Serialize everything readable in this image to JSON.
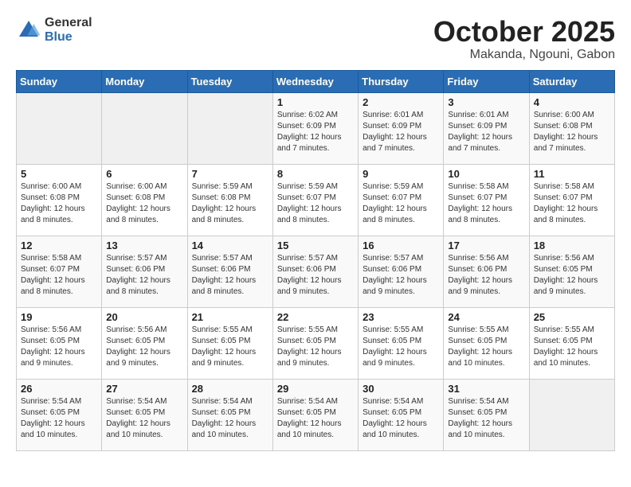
{
  "header": {
    "logo_general": "General",
    "logo_blue": "Blue",
    "title": "October 2025",
    "location": "Makanda, Ngouni, Gabon"
  },
  "weekdays": [
    "Sunday",
    "Monday",
    "Tuesday",
    "Wednesday",
    "Thursday",
    "Friday",
    "Saturday"
  ],
  "weeks": [
    [
      {
        "day": "",
        "info": ""
      },
      {
        "day": "",
        "info": ""
      },
      {
        "day": "",
        "info": ""
      },
      {
        "day": "1",
        "info": "Sunrise: 6:02 AM\nSunset: 6:09 PM\nDaylight: 12 hours\nand 7 minutes."
      },
      {
        "day": "2",
        "info": "Sunrise: 6:01 AM\nSunset: 6:09 PM\nDaylight: 12 hours\nand 7 minutes."
      },
      {
        "day": "3",
        "info": "Sunrise: 6:01 AM\nSunset: 6:09 PM\nDaylight: 12 hours\nand 7 minutes."
      },
      {
        "day": "4",
        "info": "Sunrise: 6:00 AM\nSunset: 6:08 PM\nDaylight: 12 hours\nand 7 minutes."
      }
    ],
    [
      {
        "day": "5",
        "info": "Sunrise: 6:00 AM\nSunset: 6:08 PM\nDaylight: 12 hours\nand 8 minutes."
      },
      {
        "day": "6",
        "info": "Sunrise: 6:00 AM\nSunset: 6:08 PM\nDaylight: 12 hours\nand 8 minutes."
      },
      {
        "day": "7",
        "info": "Sunrise: 5:59 AM\nSunset: 6:08 PM\nDaylight: 12 hours\nand 8 minutes."
      },
      {
        "day": "8",
        "info": "Sunrise: 5:59 AM\nSunset: 6:07 PM\nDaylight: 12 hours\nand 8 minutes."
      },
      {
        "day": "9",
        "info": "Sunrise: 5:59 AM\nSunset: 6:07 PM\nDaylight: 12 hours\nand 8 minutes."
      },
      {
        "day": "10",
        "info": "Sunrise: 5:58 AM\nSunset: 6:07 PM\nDaylight: 12 hours\nand 8 minutes."
      },
      {
        "day": "11",
        "info": "Sunrise: 5:58 AM\nSunset: 6:07 PM\nDaylight: 12 hours\nand 8 minutes."
      }
    ],
    [
      {
        "day": "12",
        "info": "Sunrise: 5:58 AM\nSunset: 6:07 PM\nDaylight: 12 hours\nand 8 minutes."
      },
      {
        "day": "13",
        "info": "Sunrise: 5:57 AM\nSunset: 6:06 PM\nDaylight: 12 hours\nand 8 minutes."
      },
      {
        "day": "14",
        "info": "Sunrise: 5:57 AM\nSunset: 6:06 PM\nDaylight: 12 hours\nand 8 minutes."
      },
      {
        "day": "15",
        "info": "Sunrise: 5:57 AM\nSunset: 6:06 PM\nDaylight: 12 hours\nand 9 minutes."
      },
      {
        "day": "16",
        "info": "Sunrise: 5:57 AM\nSunset: 6:06 PM\nDaylight: 12 hours\nand 9 minutes."
      },
      {
        "day": "17",
        "info": "Sunrise: 5:56 AM\nSunset: 6:06 PM\nDaylight: 12 hours\nand 9 minutes."
      },
      {
        "day": "18",
        "info": "Sunrise: 5:56 AM\nSunset: 6:05 PM\nDaylight: 12 hours\nand 9 minutes."
      }
    ],
    [
      {
        "day": "19",
        "info": "Sunrise: 5:56 AM\nSunset: 6:05 PM\nDaylight: 12 hours\nand 9 minutes."
      },
      {
        "day": "20",
        "info": "Sunrise: 5:56 AM\nSunset: 6:05 PM\nDaylight: 12 hours\nand 9 minutes."
      },
      {
        "day": "21",
        "info": "Sunrise: 5:55 AM\nSunset: 6:05 PM\nDaylight: 12 hours\nand 9 minutes."
      },
      {
        "day": "22",
        "info": "Sunrise: 5:55 AM\nSunset: 6:05 PM\nDaylight: 12 hours\nand 9 minutes."
      },
      {
        "day": "23",
        "info": "Sunrise: 5:55 AM\nSunset: 6:05 PM\nDaylight: 12 hours\nand 9 minutes."
      },
      {
        "day": "24",
        "info": "Sunrise: 5:55 AM\nSunset: 6:05 PM\nDaylight: 12 hours\nand 10 minutes."
      },
      {
        "day": "25",
        "info": "Sunrise: 5:55 AM\nSunset: 6:05 PM\nDaylight: 12 hours\nand 10 minutes."
      }
    ],
    [
      {
        "day": "26",
        "info": "Sunrise: 5:54 AM\nSunset: 6:05 PM\nDaylight: 12 hours\nand 10 minutes."
      },
      {
        "day": "27",
        "info": "Sunrise: 5:54 AM\nSunset: 6:05 PM\nDaylight: 12 hours\nand 10 minutes."
      },
      {
        "day": "28",
        "info": "Sunrise: 5:54 AM\nSunset: 6:05 PM\nDaylight: 12 hours\nand 10 minutes."
      },
      {
        "day": "29",
        "info": "Sunrise: 5:54 AM\nSunset: 6:05 PM\nDaylight: 12 hours\nand 10 minutes."
      },
      {
        "day": "30",
        "info": "Sunrise: 5:54 AM\nSunset: 6:05 PM\nDaylight: 12 hours\nand 10 minutes."
      },
      {
        "day": "31",
        "info": "Sunrise: 5:54 AM\nSunset: 6:05 PM\nDaylight: 12 hours\nand 10 minutes."
      },
      {
        "day": "",
        "info": ""
      }
    ]
  ]
}
